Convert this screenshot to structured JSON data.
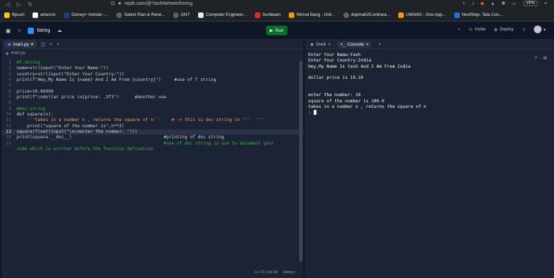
{
  "browser": {
    "url": "replit.com/@YashNehete/fstring",
    "vpn": "VPN"
  },
  "bookmarks": [
    "flipcart",
    "amezon",
    "Disney+ Hotstar -...",
    "Select Plan & Rene...",
    "ONT",
    "Computer Engineer...",
    "Sunbeam",
    "Nirmal Bang - Onli...",
    "dopmah20.onlinea...",
    "UMANG - One App...",
    "NextStep- Tata Con..."
  ],
  "topbar": {
    "repl_name": "fstring",
    "run_label": "Run",
    "invite_label": "Invite",
    "deploy_label": "Deploy"
  },
  "editor": {
    "tab_label": "main.py",
    "breadcrumb": "main.py",
    "status_position": "Ln 13, Col 43",
    "status_history": "History",
    "lines": [
      {
        "n": "1",
        "text": "#f-string",
        "cls": "c-cm"
      },
      {
        "n": "2",
        "text": "name=str(input(\"Enter Your Name:\"))",
        "cls": "ct"
      },
      {
        "n": "3",
        "text": "country=str(input(\"Enter Your Country:\"))",
        "cls": "ct"
      },
      {
        "n": "4",
        "text": "print(f\"Hey,My Name Is {name} And I Am From {country}\")     #use of f string",
        "cls": "ct"
      },
      {
        "n": "5",
        "text": "",
        "cls": "ct"
      },
      {
        "n": "6",
        "text": "price=10.09999",
        "cls": "ct"
      },
      {
        "n": "7",
        "text": "print(f\"\\ndollar price is{price: .2f}\")      #another use",
        "cls": "ct"
      },
      {
        "n": "8",
        "text": "",
        "cls": "ct"
      },
      {
        "n": "9",
        "text": "#doc-string",
        "cls": "c-cm"
      },
      {
        "n": "10",
        "text": "def square(n):",
        "cls": "ct"
      },
      {
        "n": "11",
        "text": "    '''takes in a number n , returns the square of n'''    #--> this is doc string in '''  '''",
        "cls": "c-str"
      },
      {
        "n": "12",
        "text": "    print(\"square of the number is\",n**2)",
        "cls": "ct"
      },
      {
        "n": "13",
        "text": "square(float(input(\"\\n\\nenter the number: \")))",
        "cls": "ct",
        "current": true
      },
      {
        "n": "14",
        "text": "print(square.__doc__)                                   #printing of doc string",
        "cls": "ct"
      },
      {
        "n": "15",
        "text": "                                                        #use of doc string is use to document your",
        "cls": "c-cm"
      },
      {
        "n": "",
        "text": "code which is written before the function defination",
        "cls": "c-cm"
      }
    ]
  },
  "console": {
    "tab_shell": "Shell",
    "tab_console": "Console",
    "output": [
      "Enter Your Name:Yash",
      "Enter Your Country:India",
      "Hey,My Name Is Yash And I Am From India",
      "",
      "dollar price is 10.10",
      "",
      "",
      "enter the number: 10",
      "square of the number is 100.0",
      "takes in a number n , returns the square of n"
    ],
    "prompt": "›"
  }
}
